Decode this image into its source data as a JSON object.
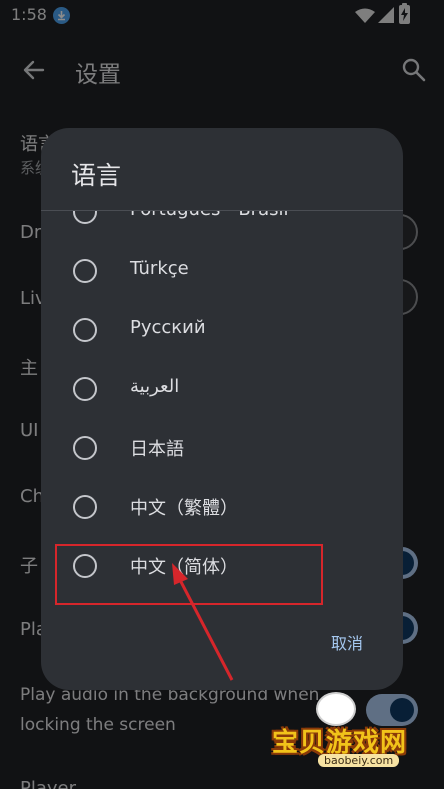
{
  "status_bar": {
    "time": "1:58"
  },
  "app_bar": {
    "title": "设置"
  },
  "background_settings": {
    "row1_title": "语言",
    "row1_sub": "系统",
    "row2_title": "Dr",
    "row3_title": "Liv",
    "row4_title": "主",
    "row5_title": "UI",
    "row6_title": "Ch",
    "row7_title": "子",
    "row8_title": "Pla",
    "play_audio_line1": "Play audio in the background when",
    "play_audio_line2": "locking the screen",
    "row_last": "Player"
  },
  "dialog": {
    "title": "语言",
    "options": [
      {
        "label": "Português - Brasil",
        "selected": false
      },
      {
        "label": "Türkçe",
        "selected": false
      },
      {
        "label": "Русский",
        "selected": false
      },
      {
        "label": "العربية",
        "selected": false
      },
      {
        "label": "日本語",
        "selected": false
      },
      {
        "label": "中文（繁體）",
        "selected": false
      },
      {
        "label": "中文（简体）",
        "selected": false
      }
    ],
    "cancel_label": "取消"
  },
  "annotation": {
    "color": "#d6262b",
    "target": "中文（简体）"
  },
  "watermark": {
    "text": "宝贝游戏网",
    "url": "baobeiy.com"
  },
  "colors": {
    "accent": "#a5c8f0",
    "dialog_bg": "#2d3035",
    "page_bg": "#1f2125"
  }
}
